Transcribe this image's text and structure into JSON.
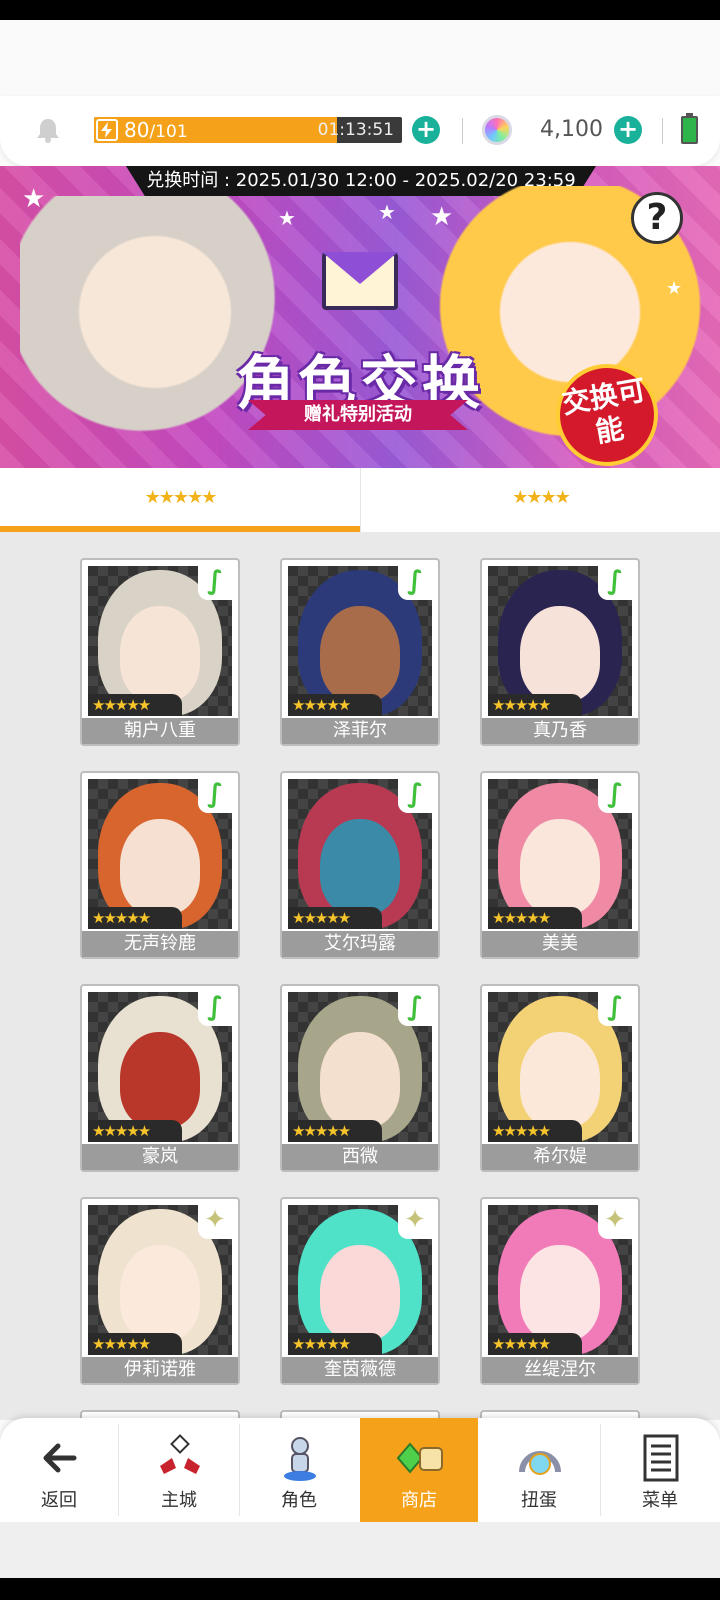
{
  "header": {
    "stamina_current": "80",
    "stamina_max": "/101",
    "stamina_fraction": 0.79,
    "stamina_timer": "01:13:51",
    "gem_count": "4,100"
  },
  "banner": {
    "exchange_period": "兑换时间 : 2025.01/30 12:00 - 2025.02/20 23:59",
    "title": "角色交换",
    "subtitle": "赠礼特别活动",
    "badge": "交换可能",
    "help_glyph": "?"
  },
  "tabs": [
    {
      "label": "★★★★★",
      "active": true
    },
    {
      "label": "★★★★",
      "active": false
    }
  ],
  "characters": [
    {
      "name": "朝户八重",
      "stars": "★★★★★",
      "element": "wind",
      "face_color": "#f6e4d6",
      "hair_color": "#d9d2c6"
    },
    {
      "name": "泽菲尔",
      "stars": "★★★★★",
      "element": "wind",
      "face_color": "#a86c4a",
      "hair_color": "#2c3a7a"
    },
    {
      "name": "真乃香",
      "stars": "★★★★★",
      "element": "wind",
      "face_color": "#f6e2d8",
      "hair_color": "#2a2450"
    },
    {
      "name": "无声铃鹿",
      "stars": "★★★★★",
      "element": "wind",
      "face_color": "#f6e0d2",
      "hair_color": "#d8642e"
    },
    {
      "name": "艾尔玛露",
      "stars": "★★★★★",
      "element": "wind",
      "face_color": "#3a8aa8",
      "hair_color": "#b83a52"
    },
    {
      "name": "美美",
      "stars": "★★★★★",
      "element": "wind",
      "face_color": "#fbe6dc",
      "hair_color": "#f08aa4"
    },
    {
      "name": "豪岚",
      "stars": "★★★★★",
      "element": "wind",
      "face_color": "#b8362a",
      "hair_color": "#e8e0d0"
    },
    {
      "name": "西微",
      "stars": "★★★★★",
      "element": "wind",
      "face_color": "#f4e0cf",
      "hair_color": "#a8a68a"
    },
    {
      "name": "希尔媞",
      "stars": "★★★★★",
      "element": "wind",
      "face_color": "#fbe8d8",
      "hair_color": "#f3d276"
    },
    {
      "name": "伊莉诺雅",
      "stars": "★★★★★",
      "element": "light",
      "face_color": "#fbe9dc",
      "hair_color": "#efe2cf"
    },
    {
      "name": "奎茵薇德",
      "stars": "★★★★★",
      "element": "light",
      "face_color": "#fbd9d8",
      "hair_color": "#4fe2c8"
    },
    {
      "name": "丝缇涅尔",
      "stars": "★★★★★",
      "element": "light",
      "face_color": "#fde4e4",
      "hair_color": "#f17ab8"
    }
  ],
  "bottom_nav": [
    {
      "label": "返回",
      "icon": "back-arrow-icon",
      "active": false
    },
    {
      "label": "主城",
      "icon": "town-icon",
      "active": false
    },
    {
      "label": "角色",
      "icon": "character-icon",
      "active": false
    },
    {
      "label": "商店",
      "icon": "shop-icon",
      "active": true
    },
    {
      "label": "扭蛋",
      "icon": "gacha-icon",
      "active": false
    },
    {
      "label": "菜单",
      "icon": "menu-list-icon",
      "active": false
    }
  ],
  "colors": {
    "accent": "#f5a21a",
    "plus": "#1ab19a",
    "card_label_bg": "#9c9c9c",
    "wind_element": "#3fbf3a"
  }
}
